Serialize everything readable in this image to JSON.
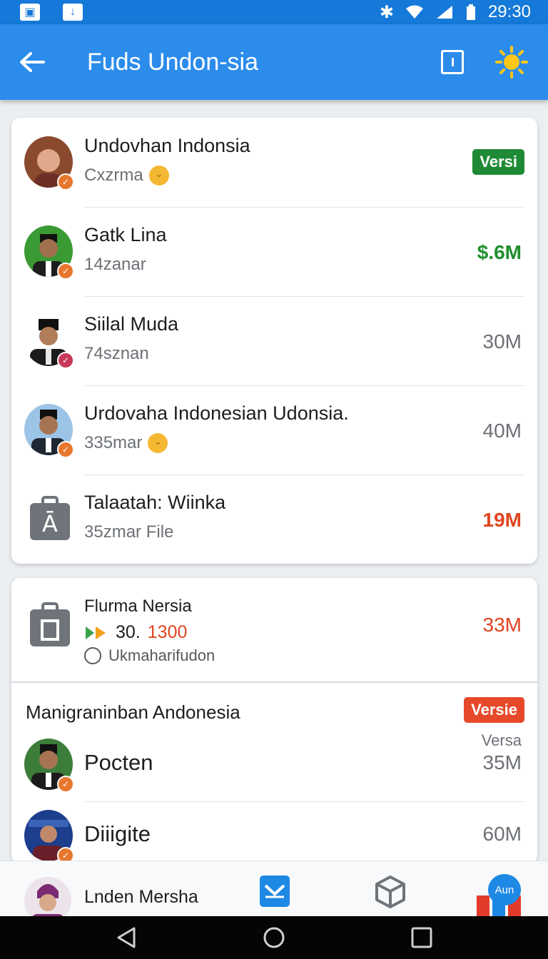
{
  "status": {
    "time": "29:30"
  },
  "appbar": {
    "title": "Fuds Undon-sia"
  },
  "list1": [
    {
      "name": "Undovhan Indonsia",
      "sub": "Cxzrma",
      "value": "Versi",
      "kind": "pill"
    },
    {
      "name": "Gatk Lina",
      "sub": "14zanar",
      "value": "$.6M",
      "kind": "green"
    },
    {
      "name": "Siilal Muda",
      "sub": "74sznan",
      "value": "30M",
      "kind": "plain"
    },
    {
      "name": "Urdovaha Indonesian Udonsia.",
      "sub": "335mar",
      "value": "40M",
      "kind": "plain"
    },
    {
      "name": "Talaatah: Wiinka",
      "sub": "35zmar File",
      "value": "19M",
      "kind": "red"
    }
  ],
  "card2": {
    "title": "Flurma Nersia",
    "amount_num": "30.",
    "amount_red": "1300",
    "sub": "Ukmaharifudon",
    "value": "33M"
  },
  "group": {
    "title": "Manigraninban Andonesia",
    "badge": "Versie",
    "badge_sub": "Versa",
    "items": [
      {
        "name": "Pocten",
        "value": "35M"
      },
      {
        "name": "Diiigite",
        "value": "60M"
      }
    ]
  },
  "bottom": {
    "label": "Lnden Mersha",
    "app_badge": "Aun"
  }
}
